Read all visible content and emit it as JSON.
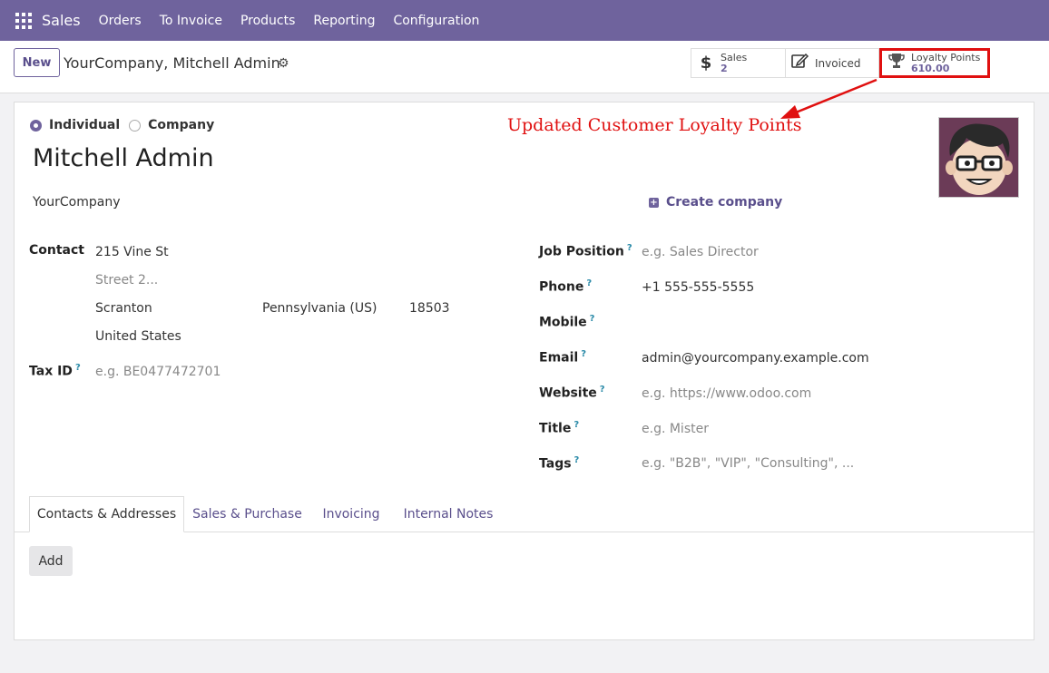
{
  "navbar": {
    "brand": "Sales",
    "items": [
      "Orders",
      "To Invoice",
      "Products",
      "Reporting",
      "Configuration"
    ]
  },
  "control_panel": {
    "new_label": "New",
    "breadcrumb": "YourCompany, Mitchell Admin"
  },
  "stats": {
    "sales_label": "Sales",
    "sales_value": "2",
    "invoiced_label": "Invoiced",
    "loyalty_label": "Loyalty Points",
    "loyalty_value": "610.00"
  },
  "annotation": "Updated Customer Loyalty Points",
  "form": {
    "type_individual": "Individual",
    "type_company": "Company",
    "name": "Mitchell Admin",
    "company": "YourCompany",
    "create_company": "Create company",
    "contact_label": "Contact",
    "street": "215 Vine St",
    "street2_placeholder": "Street 2...",
    "city": "Scranton",
    "state": "Pennsylvania (US)",
    "zip": "18503",
    "country": "United States",
    "tax_label": "Tax ID",
    "tax_placeholder": "e.g. BE0477472701",
    "job_label": "Job Position",
    "job_placeholder": "e.g. Sales Director",
    "phone_label": "Phone",
    "phone": "+1 555-555-5555",
    "mobile_label": "Mobile",
    "email_label": "Email",
    "email": "admin@yourcompany.example.com",
    "website_label": "Website",
    "website_placeholder": "e.g. https://www.odoo.com",
    "title_label": "Title",
    "title_placeholder": "e.g. Mister",
    "tags_label": "Tags",
    "tags_placeholder": "e.g. \"B2B\", \"VIP\", \"Consulting\", ...",
    "help_mark": "?"
  },
  "tabs": [
    "Contacts & Addresses",
    "Sales & Purchase",
    "Invoicing",
    "Internal Notes"
  ],
  "add_label": "Add"
}
